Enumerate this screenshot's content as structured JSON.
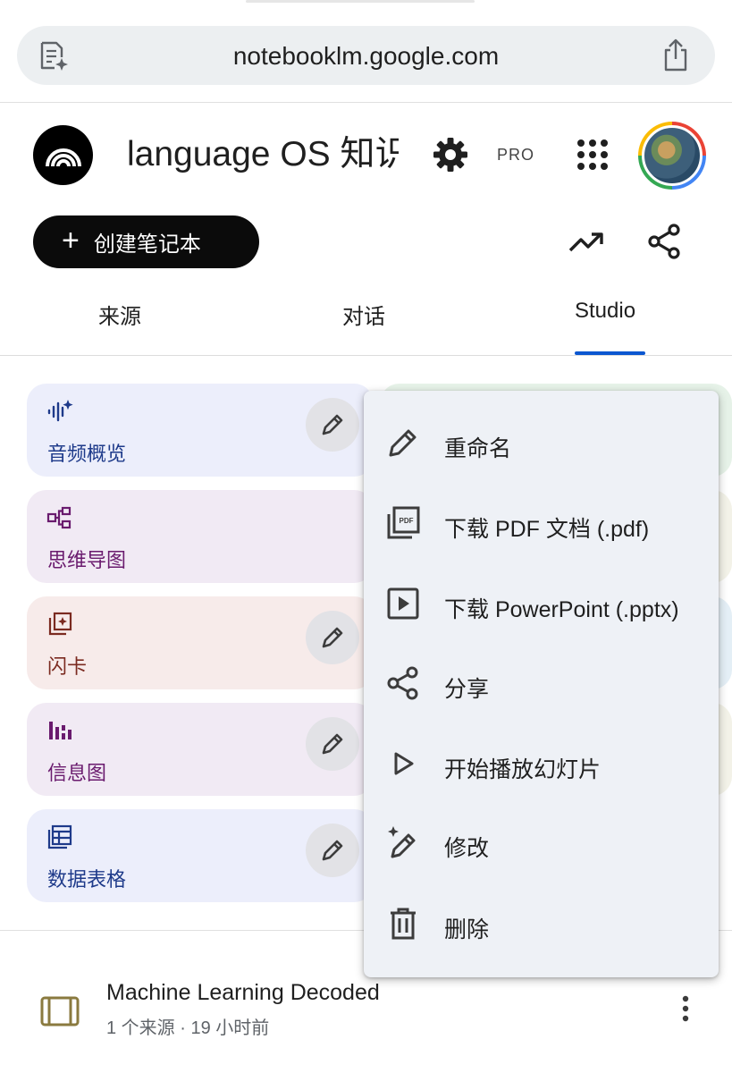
{
  "browser": {
    "url": "notebooklm.google.com",
    "left_icon": "page-sparkle-icon",
    "right_icon": "share-upload-icon"
  },
  "header": {
    "notebook_title": "language OS 知识",
    "settings_icon": "gear-icon",
    "pro_badge": "PRO",
    "apps_icon": "apps-grid-icon",
    "logo_icon": "notebooklm-logo-icon"
  },
  "actions": {
    "create_label": "创建笔记本",
    "create_icon_glyph": "+",
    "analytics_icon": "trending-up-icon",
    "share_icon": "share-icon"
  },
  "tabs": [
    {
      "label": "来源",
      "active": false
    },
    {
      "label": "对话",
      "active": false
    },
    {
      "label": "Studio",
      "active": true
    }
  ],
  "studio_cards": [
    {
      "label": "音频概览",
      "icon": "audio-sparkle-icon",
      "color": "#1e3a8a",
      "bg": "#eceefb",
      "has_edit": true
    },
    {
      "label": "思维导图",
      "icon": "mind-map-icon",
      "color": "#6a1b6e",
      "bg": "#f1eaf4",
      "has_edit": false
    },
    {
      "label": "闪卡",
      "icon": "flashcard-icon",
      "color": "#7b2a20",
      "bg": "#f7ebea",
      "has_edit": true
    },
    {
      "label": "信息图",
      "icon": "infographic-icon",
      "color": "#6a1b6e",
      "bg": "#f1eaf4",
      "has_edit": true
    },
    {
      "label": "数据表格",
      "icon": "table-icon",
      "color": "#1e3a8a",
      "bg": "#eceefb",
      "has_edit": true
    }
  ],
  "context_menu": {
    "items": [
      {
        "label": "重命名",
        "icon": "pencil-icon"
      },
      {
        "label": "下载 PDF 文档 (.pdf)",
        "icon": "pdf-icon"
      },
      {
        "label": "下载 PowerPoint (.pptx)",
        "icon": "slideshow-icon"
      },
      {
        "label": "分享",
        "icon": "share-icon"
      },
      {
        "label": "开始播放幻灯片",
        "icon": "play-icon"
      },
      {
        "label": "修改",
        "icon": "magic-pencil-icon"
      },
      {
        "label": "删除",
        "icon": "trash-icon"
      }
    ]
  },
  "note": {
    "title": "Machine Learning Decoded",
    "subtitle": "1 个来源 · 19 小时前",
    "icon": "slides-icon",
    "more_icon": "more-vert-icon"
  },
  "colors": {
    "accent_blue": "#0b57d0",
    "menu_bg": "#eef1f6",
    "button_dark": "#0b0b0b"
  }
}
